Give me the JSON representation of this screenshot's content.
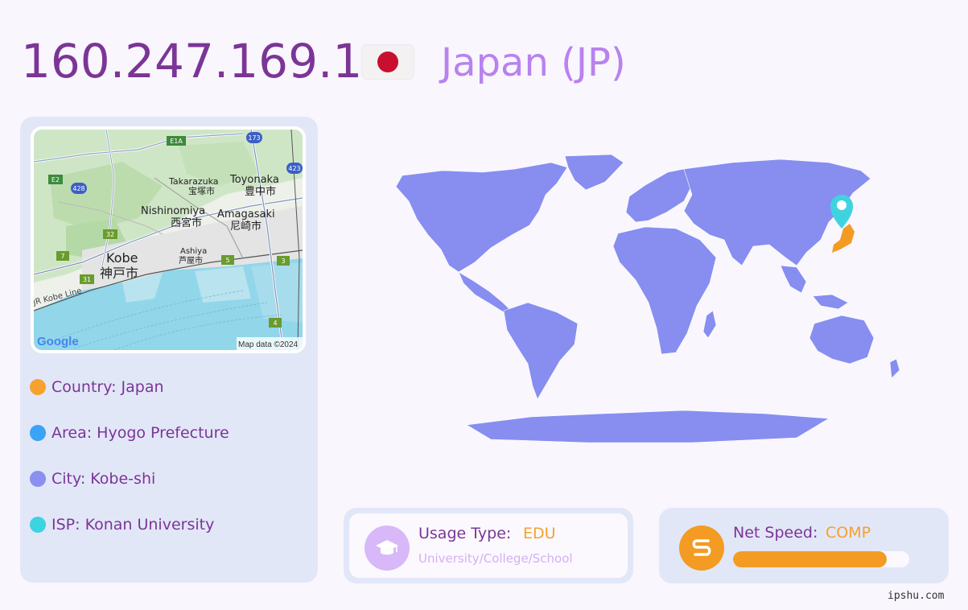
{
  "header": {
    "ip": "160.247.169.1",
    "country": "Japan (JP)",
    "flag_icon": "japan-flag-icon"
  },
  "map": {
    "labels": {
      "kobe_en": "Kobe",
      "kobe_jp": "神戸市",
      "nishinomiya_en": "Nishinomiya",
      "nishinomiya_jp": "西宮市",
      "takarazuka_en": "Takarazuka",
      "takarazuka_jp": "宝塚市",
      "toyonaka_en": "Toyonaka",
      "toyonaka_jp": "豊中市",
      "amagasaki_en": "Amagasaki",
      "amagasaki_jp": "尼崎市",
      "ashiya_en": "Ashiya",
      "ashiya_jp": "芦屋市",
      "jr_line": "JR Kobe Line"
    },
    "route_shields": [
      "E1A",
      "173",
      "E2",
      "428",
      "423",
      "32",
      "7",
      "31",
      "5",
      "3",
      "4"
    ],
    "google_logo": "Google",
    "attribution": "Map data ©2024"
  },
  "info": [
    {
      "label": "Country: Japan",
      "color": "#f7a22f"
    },
    {
      "label": "Area: Hyogo Prefecture",
      "color": "#3aa3f5"
    },
    {
      "label": "City: Kobe-shi",
      "color": "#8a8ff0"
    },
    {
      "label": "ISP: Konan University",
      "color": "#3bd4e0"
    }
  ],
  "world_map": {
    "land_color": "#878ef0",
    "highlight_color": "#f39b22",
    "pin_color": "#3fd3e0",
    "pin_icon": "map-pin-icon"
  },
  "usage": {
    "label": "Usage Type:",
    "value": "EDU",
    "subtitle": "University/College/School",
    "icon": "graduation-cap-icon"
  },
  "speed": {
    "label": "Net Speed:",
    "value": "COMP",
    "fill_fraction": 0.87,
    "icon": "speed-road-icon"
  },
  "footer": "ipshu.com"
}
